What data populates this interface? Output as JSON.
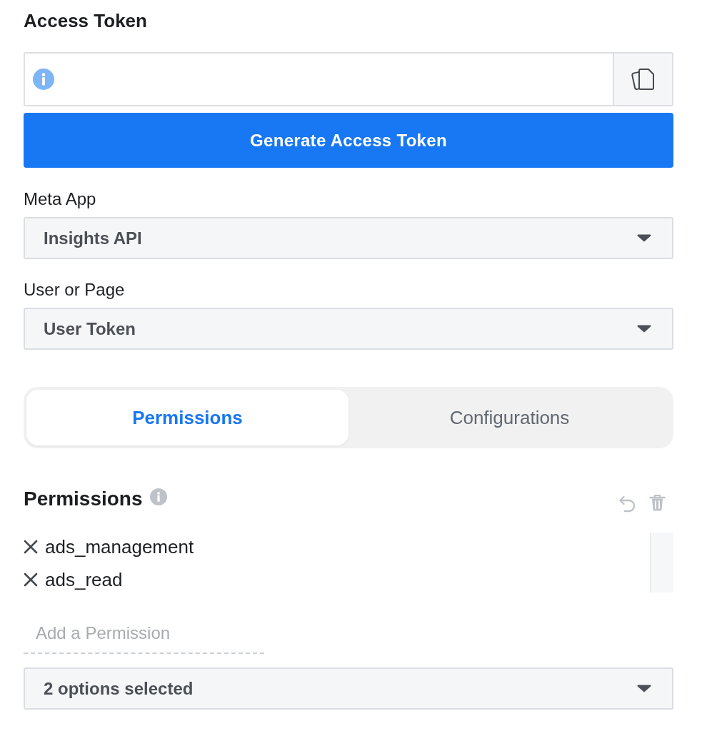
{
  "access_token": {
    "title": "Access Token"
  },
  "generate_button": {
    "label": "Generate Access Token"
  },
  "meta_app": {
    "label": "Meta App",
    "value": "Insights API"
  },
  "user_or_page": {
    "label": "User or Page",
    "value": "User Token"
  },
  "tabs": [
    {
      "label": "Permissions",
      "selected": true
    },
    {
      "label": "Configurations",
      "selected": false
    }
  ],
  "permissions": {
    "title": "Permissions",
    "items": [
      {
        "name": "ads_management"
      },
      {
        "name": "ads_read"
      }
    ],
    "add_field": {
      "placeholder": "Add a Permission"
    },
    "summary": {
      "value": "2 options selected"
    }
  }
}
